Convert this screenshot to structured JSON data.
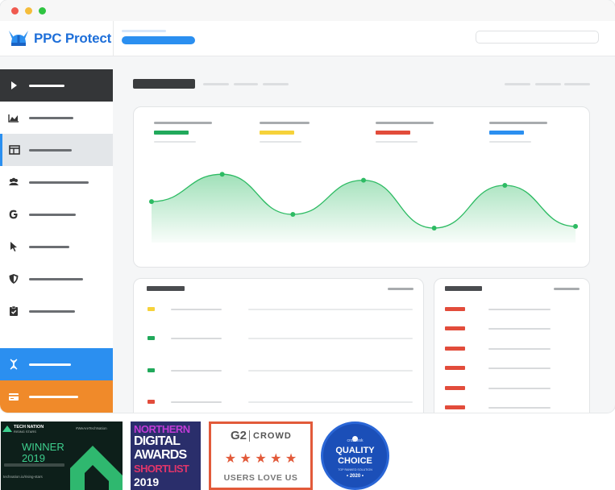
{
  "app": {
    "name": "PPC Protect"
  },
  "colors": {
    "brand_blue": "#2b8ff0",
    "sidebar_dark": "#343638",
    "accent_orange": "#f08a2a",
    "series_green": "#2dbb63",
    "legend_green": "#21a95b",
    "legend_yellow": "#f6d23a",
    "legend_red": "#e24c3b",
    "legend_blue": "#2b8ff0"
  },
  "sidebar": {
    "items": [
      {
        "icon": "play-icon",
        "style": "dark"
      },
      {
        "icon": "area-chart-icon",
        "style": "normal"
      },
      {
        "icon": "layout-table-icon",
        "style": "active"
      },
      {
        "icon": "users-icon",
        "style": "normal"
      },
      {
        "icon": "google-g-icon",
        "style": "normal"
      },
      {
        "icon": "cursor-icon",
        "style": "normal"
      },
      {
        "icon": "shield-icon",
        "style": "normal"
      },
      {
        "icon": "clipboard-check-icon",
        "style": "normal"
      },
      {
        "icon": "dna-icon",
        "style": "blue"
      },
      {
        "icon": "credit-card-icon",
        "style": "orange"
      }
    ]
  },
  "chart_data": {
    "type": "area",
    "x": [
      1,
      2,
      3,
      4,
      5,
      6,
      7
    ],
    "series": [
      {
        "values": [
          0.48,
          0.8,
          0.33,
          0.73,
          0.17,
          0.67,
          0.19
        ]
      }
    ],
    "ylim": [
      0,
      1
    ],
    "grid": false
  },
  "badges": {
    "tech_nation": {
      "org": "TECH NATION",
      "sub": "RISING STARS",
      "hashtag": "#WeAreTechNation",
      "title": "WINNER",
      "year": "2019",
      "url": "technation.io/rising-stars"
    },
    "northern_digital": {
      "line1": "NORTHERN",
      "line2": "DIGITAL",
      "line3": "AWARDS",
      "line4": "SHORTLIST",
      "year": "2019"
    },
    "g2": {
      "logo": "G2",
      "crowd": "CROWD",
      "stars": "★ ★ ★ ★ ★",
      "tagline": "USERS LOVE US"
    },
    "crozdesk": {
      "brand": "crozdesk",
      "line1": "QUALITY",
      "line2": "CHOICE",
      "small": "TOP RANKED SOLUTION",
      "year": "• 2020 •"
    }
  }
}
